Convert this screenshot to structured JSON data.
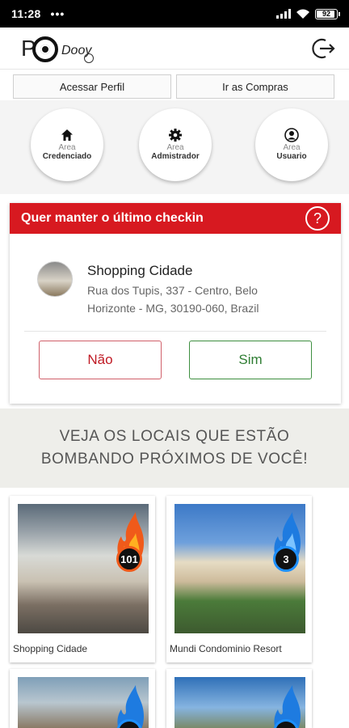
{
  "status_bar": {
    "time": "11:28",
    "dots": "•••",
    "battery": "92"
  },
  "app": {
    "logo_text": "Dooy",
    "logout_icon": "logout-icon"
  },
  "top_buttons": {
    "profile": "Acessar Perfil",
    "shopping": "Ir as Compras"
  },
  "areas": [
    {
      "line1": "Area",
      "line2": "Credenciado",
      "icon": "home-icon"
    },
    {
      "line1": "Area",
      "line2": "Admistrador",
      "icon": "gear-icon"
    },
    {
      "line1": "Area",
      "line2": "Usuario",
      "icon": "user-icon"
    }
  ],
  "checkin": {
    "title": "Quer manter o último checkin",
    "help": "?",
    "place_name": "Shopping Cidade",
    "place_address": "Rua dos Tupis, 337 - Centro, Belo Horizonte - MG, 30190-060, Brazil",
    "no_label": "Não",
    "yes_label": "Sim",
    "colors": {
      "header": "#d71920",
      "no": "#c01a24",
      "yes": "#2e7d32"
    }
  },
  "promo": {
    "line1": "VEJA OS LOCAIS QUE ESTÃO",
    "line2": "BOMBANDO PRÓXIMOS DE VOCÊ!"
  },
  "places": [
    {
      "name": "Shopping Cidade",
      "count": "101",
      "flame": "orange"
    },
    {
      "name": "Mundi Condominio Resort",
      "count": "3",
      "flame": "blue"
    },
    {
      "name": "",
      "count": "",
      "flame": "blue"
    },
    {
      "name": "",
      "count": "",
      "flame": "blue"
    }
  ]
}
